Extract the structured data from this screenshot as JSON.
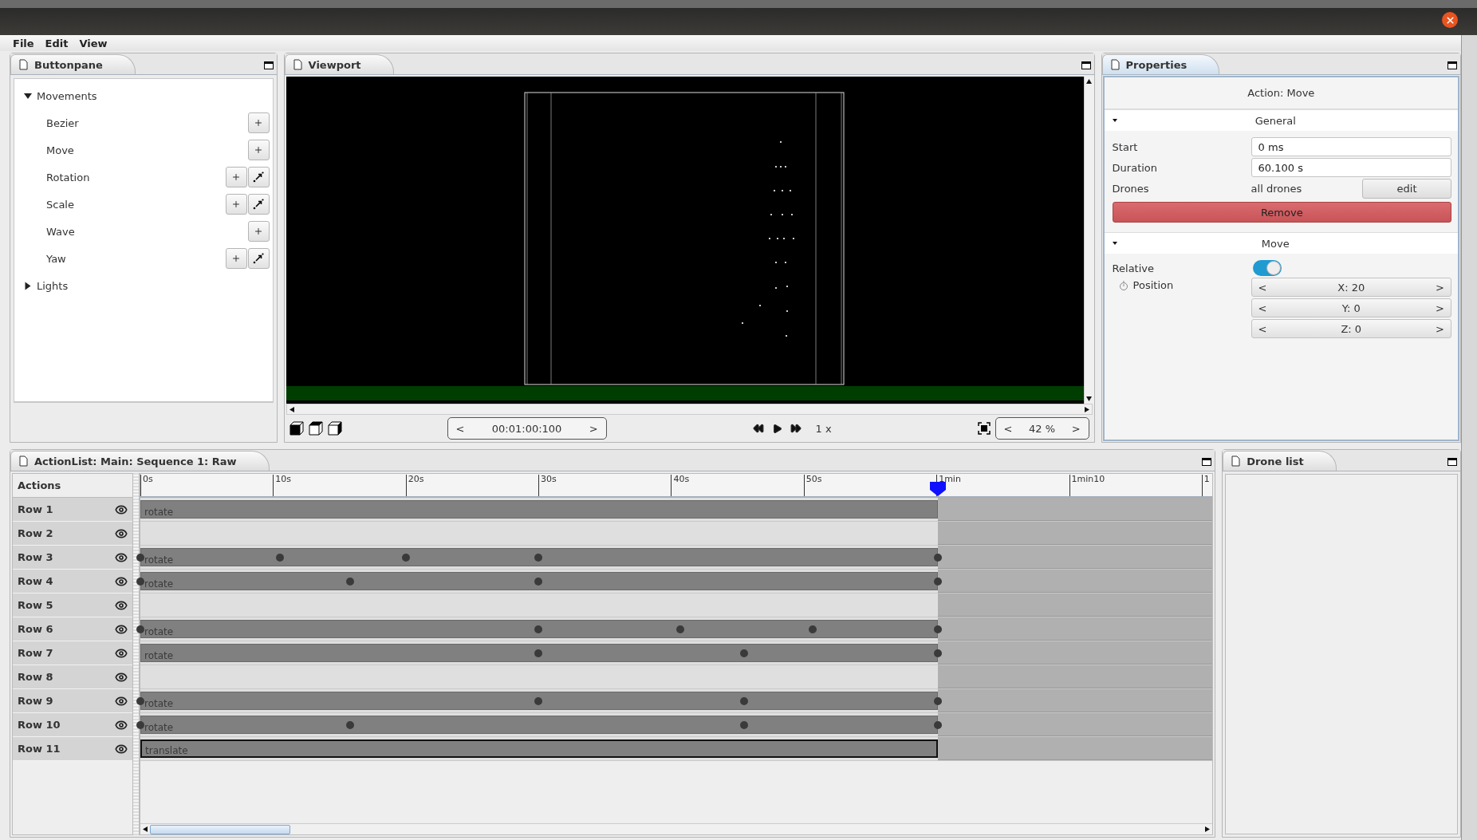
{
  "menu": [
    "File",
    "Edit",
    "View"
  ],
  "buttonpane": {
    "title": "Buttonpane",
    "tree": [
      {
        "label": "Movements",
        "expanded": true,
        "children": [
          {
            "label": "Bezier",
            "kind": "add"
          },
          {
            "label": "Move",
            "kind": "add"
          },
          {
            "label": "Rotation",
            "kind": "add-pick"
          },
          {
            "label": "Scale",
            "kind": "add-pick"
          },
          {
            "label": "Wave",
            "kind": "add"
          },
          {
            "label": "Yaw",
            "kind": "add-pick"
          }
        ]
      },
      {
        "label": "Lights",
        "expanded": false
      }
    ]
  },
  "viewport": {
    "title": "Viewport",
    "time": {
      "prev": "<",
      "value": "00:01:00:100",
      "next": ">"
    },
    "speed": "1 x",
    "zoom": {
      "prev": "<",
      "value": "42 %",
      "next": ">"
    }
  },
  "properties": {
    "title": "Properties",
    "heading": "Action: Move",
    "general": {
      "title": "General",
      "expanded": true,
      "fields": [
        {
          "label": "Start",
          "value": "0 ms"
        },
        {
          "label": "Duration",
          "value": "60.100 s"
        }
      ],
      "drones": {
        "label": "Drones",
        "value": "all drones",
        "button": "edit"
      },
      "remove_button": "Remove"
    },
    "move": {
      "title": "Move",
      "expanded": true,
      "relative": {
        "label": "Relative",
        "on": true
      },
      "position": {
        "label": "Position",
        "components": [
          {
            "prev": "<",
            "value": "X: 20",
            "next": ">"
          },
          {
            "prev": "<",
            "value": "Y: 0",
            "next": ">"
          },
          {
            "prev": "<",
            "value": "Z: 0",
            "next": ">"
          }
        ]
      }
    }
  },
  "action_list": {
    "title": "ActionList: Main: Sequence 1: Raw",
    "header": "Actions",
    "ruler": [
      "0s",
      "10s",
      "20s",
      "30s",
      "40s",
      "50s",
      "1min",
      "1min10",
      "1"
    ],
    "playhead": {
      "level": 0.744
    },
    "rows": [
      {
        "label": "Row 1",
        "visible": true,
        "action": {
          "label": "rotate",
          "selected": false
        }
      },
      {
        "label": "Row 2",
        "visible": true
      },
      {
        "label": "Row 3",
        "visible": true,
        "action": {
          "label": "rotate",
          "selected": false
        }
      },
      {
        "label": "Row 4",
        "visible": true,
        "action": {
          "label": "rotate",
          "selected": false
        }
      },
      {
        "label": "Row 5",
        "visible": true
      },
      {
        "label": "Row 6",
        "visible": true,
        "action": {
          "label": "rotate",
          "selected": false
        }
      },
      {
        "label": "Row 7",
        "visible": true,
        "action": {
          "label": "rotate",
          "selected": false
        }
      },
      {
        "label": "Row 8",
        "visible": true
      },
      {
        "label": "Row 9",
        "visible": true,
        "action": {
          "label": "rotate",
          "selected": false
        }
      },
      {
        "label": "Row 10",
        "visible": true,
        "action": {
          "label": "rotate",
          "selected": false
        }
      },
      {
        "label": "Row 11",
        "visible": true,
        "action": {
          "label": "translate",
          "selected": true
        }
      }
    ]
  },
  "drone_list": {
    "title": "Drone list"
  }
}
